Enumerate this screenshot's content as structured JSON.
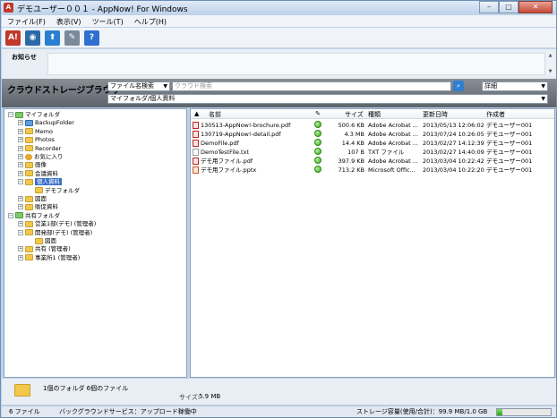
{
  "window": {
    "title": "デモユーザー００１ - AppNow! For Windows",
    "controls": [
      "–",
      "□",
      "✕"
    ]
  },
  "menu": [
    "ファイル(F)",
    "表示(V)",
    "ツール(T)",
    "ヘルプ(H)"
  ],
  "toolbar": {
    "buttons": [
      {
        "icon": "app-logo-icon",
        "glyph": "A!",
        "color": "#c0392b"
      },
      {
        "icon": "globe-icon",
        "glyph": "◉",
        "color": "#2b6aa8"
      },
      {
        "icon": "arrow-up-icon",
        "glyph": "⬆",
        "color": "#2b7fd0"
      },
      {
        "icon": "tools-icon",
        "glyph": "✎",
        "color": "#7a8a9a"
      },
      {
        "icon": "help-icon",
        "glyph": "?",
        "color": "#2f6fd0"
      }
    ]
  },
  "notice": {
    "label": "お知らせ",
    "text": ""
  },
  "browser": {
    "title": "クラウドストレージブラウザ",
    "search_type": "ファイル名検索",
    "search_placeholder": "クラウド検索",
    "view_mode": "詳細",
    "path": "マイフォルダ/個人資料"
  },
  "tree": [
    {
      "label": "マイフォルダ",
      "level": 0,
      "exp": "−",
      "folder": "green"
    },
    {
      "label": "BackupFolder",
      "level": 1,
      "exp": "+",
      "folder": "blue"
    },
    {
      "label": "Memo",
      "level": 1,
      "exp": "+",
      "folder": "yellow"
    },
    {
      "label": "Photos",
      "level": 1,
      "exp": "+",
      "folder": "yellow"
    },
    {
      "label": "Recorder",
      "level": 1,
      "exp": "+",
      "folder": "yellow"
    },
    {
      "label": "お気に入り",
      "level": 1,
      "exp": "+",
      "folder": "fav"
    },
    {
      "label": "画像",
      "level": 1,
      "exp": "+",
      "folder": "yellow"
    },
    {
      "label": "会議資料",
      "level": 1,
      "exp": "+",
      "folder": "yellow"
    },
    {
      "label": "個人資料",
      "level": 1,
      "exp": "−",
      "folder": "yellow",
      "selected": true
    },
    {
      "label": "デモフォルダ",
      "level": 2,
      "exp": "",
      "folder": "yellow"
    },
    {
      "label": "図面",
      "level": 1,
      "exp": "+",
      "folder": "yellow"
    },
    {
      "label": "販促資料",
      "level": 1,
      "exp": "+",
      "folder": "yellow"
    },
    {
      "label": "共有フォルダ",
      "level": 0,
      "exp": "−",
      "folder": "green"
    },
    {
      "label": "営業1部(デモ) (管理者)",
      "level": 1,
      "exp": "+",
      "folder": "yellow"
    },
    {
      "label": "開発部(デモ) (管理者)",
      "level": 1,
      "exp": "−",
      "folder": "yellow"
    },
    {
      "label": "図面",
      "level": 2,
      "exp": "",
      "folder": "yellow"
    },
    {
      "label": "共有 (管理者)",
      "level": 1,
      "exp": "+",
      "folder": "yellow"
    },
    {
      "label": "事業所1 (管理者)",
      "level": 1,
      "exp": "+",
      "folder": "yellow"
    }
  ],
  "list": {
    "columns": [
      "名前",
      "サイズ",
      "種類",
      "更新日時",
      "作成者"
    ],
    "rows": [
      {
        "name": "130513-AppNow!-brochure.pdf",
        "icon": "pdf",
        "size": "500.6 KB",
        "type": "Adobe Acrobat ...",
        "modified": "2013/05/13 12:06:02",
        "creator": "デモユーザー001"
      },
      {
        "name": "130719-AppNow!-detail.pdf",
        "icon": "pdf",
        "size": "4.3 MB",
        "type": "Adobe Acrobat ...",
        "modified": "2013/07/24 10:26:05",
        "creator": "デモユーザー001"
      },
      {
        "name": "DemoFile.pdf",
        "icon": "pdf",
        "size": "14.4 KB",
        "type": "Adobe Acrobat ...",
        "modified": "2013/02/27 14:12:39",
        "creator": "デモユーザー001"
      },
      {
        "name": "DemoTestFile.txt",
        "icon": "txt",
        "size": "107 B",
        "type": "TXT ファイル",
        "modified": "2013/02/27 14:40:09",
        "creator": "デモユーザー001"
      },
      {
        "name": "デモ用ファイル.pdf",
        "icon": "pdf",
        "size": "397.9 KB",
        "type": "Adobe Acrobat ...",
        "modified": "2013/03/04 10:22:42",
        "creator": "デモユーザー001"
      },
      {
        "name": "デモ用ファイル.pptx",
        "icon": "pptx",
        "size": "713.2 KB",
        "type": "Microsoft Offic...",
        "modified": "2013/03/04 10:22:20",
        "creator": "デモユーザー001"
      }
    ]
  },
  "info": {
    "summary": "1個のフォルダ 6個のファイル",
    "size_label": "サイズ:",
    "size_value": "5.9 MB"
  },
  "status": {
    "file_count": "6 ファイル",
    "background_service": "バックグラウンドサービス：アップロード稼働中",
    "storage": "ストレージ容量(使用/合計)：99.9 MB/1.0 GB",
    "storage_used_fraction": 0.1
  }
}
